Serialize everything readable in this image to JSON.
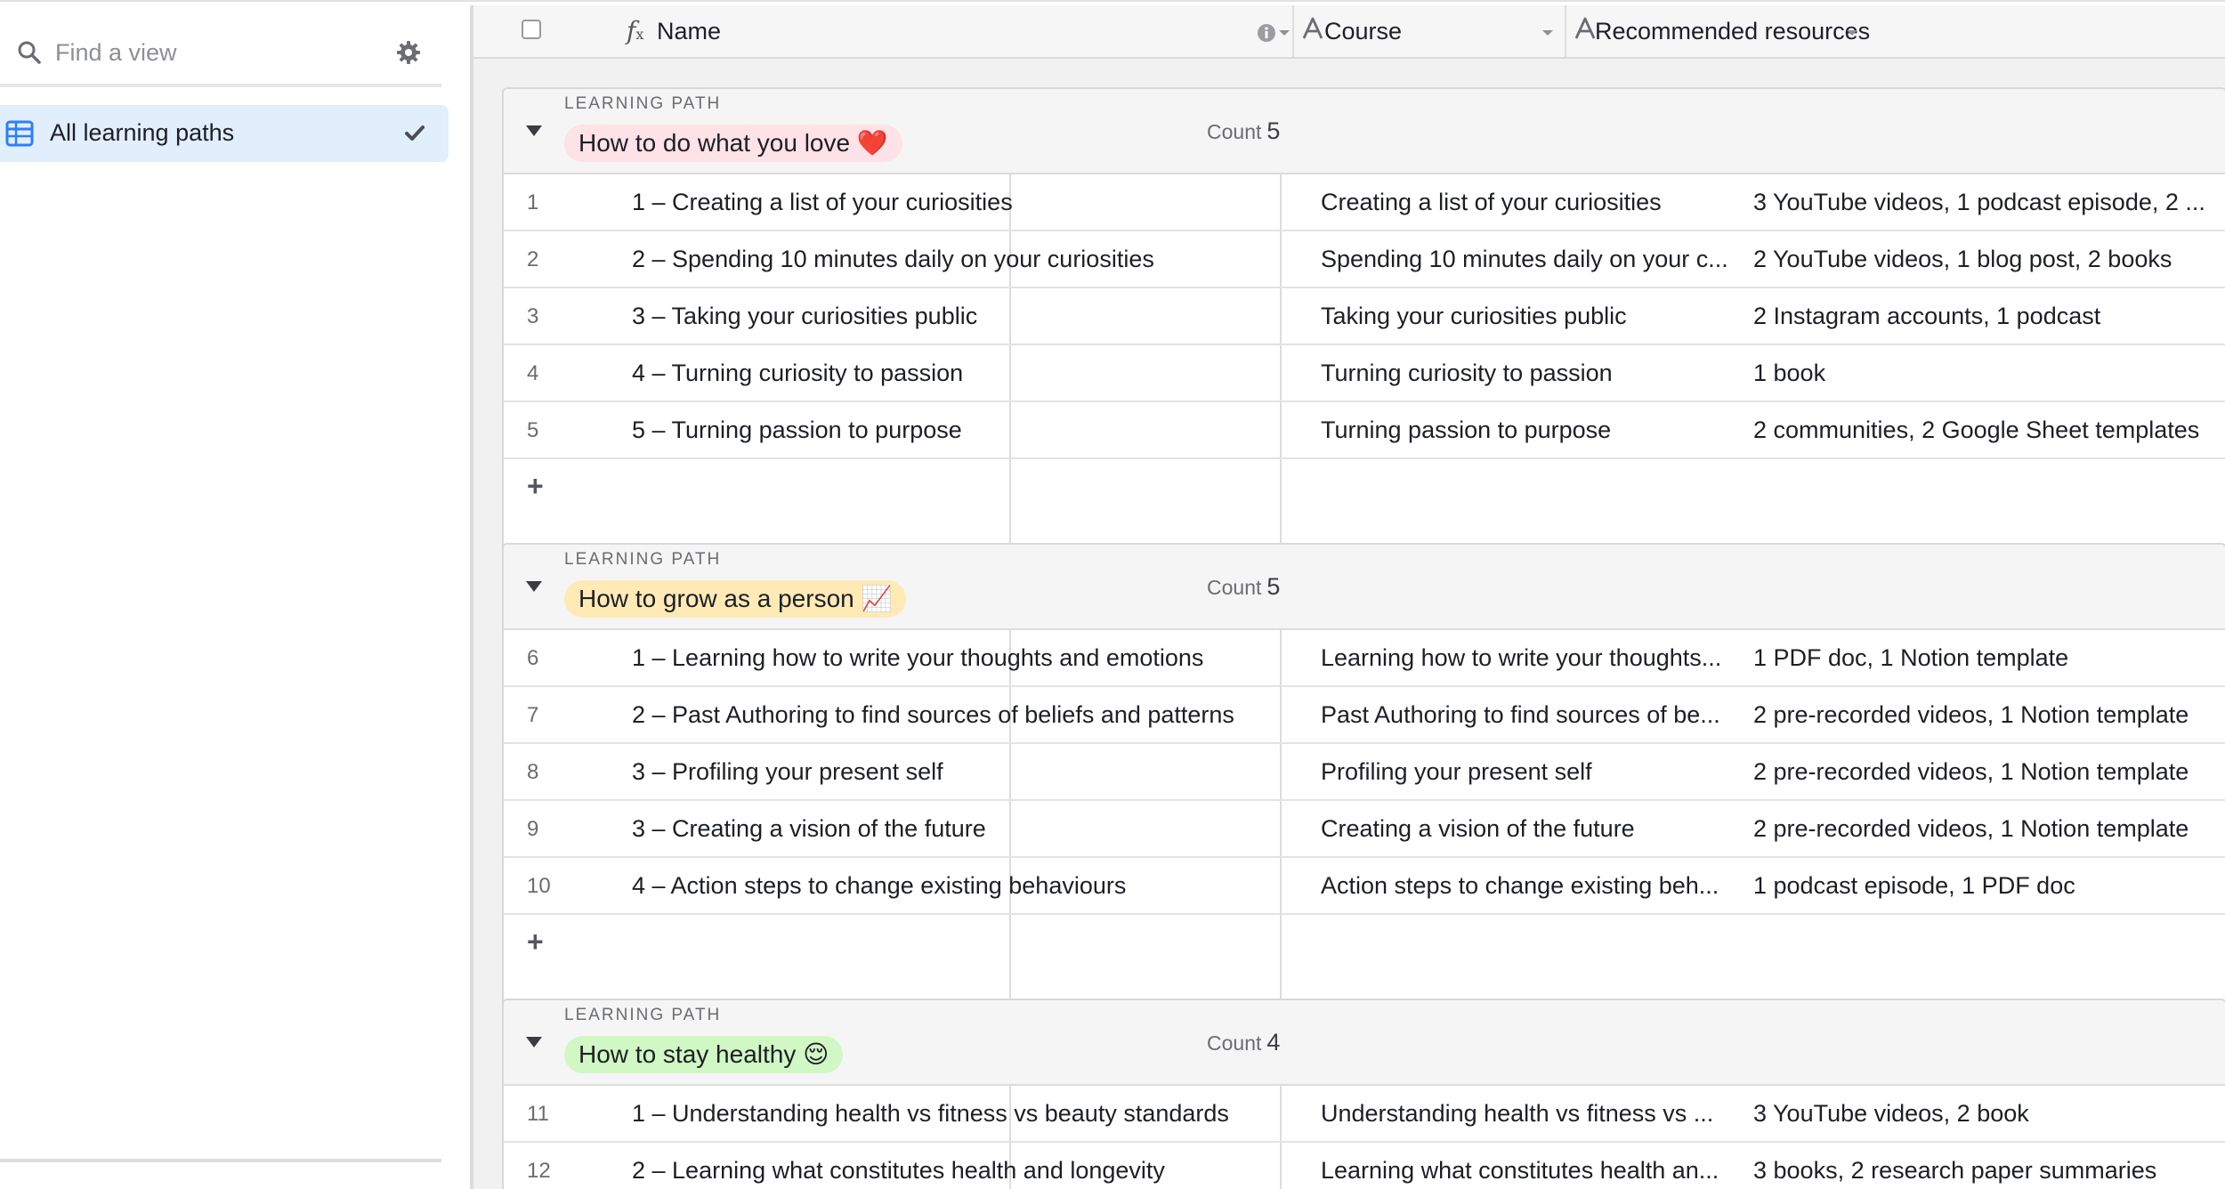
{
  "sidebar": {
    "search_placeholder": "Find a view",
    "views": [
      {
        "label": "All learning paths",
        "active": true
      }
    ]
  },
  "fields": {
    "name": "Name",
    "course": "Course",
    "resources": "Recommended resources"
  },
  "group_label": "LEARNING PATH",
  "count_label": "Count",
  "groups": [
    {
      "title": "How to do what you love ❤️",
      "color": "#fde2e8",
      "count": "5",
      "rows": [
        {
          "num": "1",
          "name": "1 – Creating a list of your curiosities",
          "course": "Creating a list of your curiosities",
          "resources": "3 YouTube videos, 1 podcast episode, 2 ..."
        },
        {
          "num": "2",
          "name": "2 – Spending 10 minutes daily on your curiosities",
          "course": "Spending 10 minutes daily on your c...",
          "resources": "2 YouTube videos, 1 blog post, 2 books"
        },
        {
          "num": "3",
          "name": "3 – Taking your curiosities public",
          "course": "Taking your curiosities public",
          "resources": "2 Instagram accounts, 1 podcast"
        },
        {
          "num": "4",
          "name": "4 – Turning curiosity to passion",
          "course": "Turning curiosity to passion",
          "resources": "1 book"
        },
        {
          "num": "5",
          "name": "5 – Turning passion to purpose",
          "course": "Turning passion to purpose",
          "resources": "2 communities, 2 Google Sheet templates"
        }
      ]
    },
    {
      "title": "How to grow as a person 📈",
      "color": "#ffeab6",
      "count": "5",
      "rows": [
        {
          "num": "6",
          "name": "1 – Learning how to write your thoughts and emotions",
          "course": "Learning how to write your thoughts...",
          "resources": "1 PDF doc, 1 Notion template"
        },
        {
          "num": "7",
          "name": "2 – Past Authoring to find sources of beliefs and patterns",
          "course": "Past Authoring to find sources of be...",
          "resources": "2 pre-recorded videos, 1 Notion template"
        },
        {
          "num": "8",
          "name": "3 – Profiling your present self",
          "course": "Profiling your present self",
          "resources": "2 pre-recorded videos, 1 Notion template"
        },
        {
          "num": "9",
          "name": "3 – Creating a vision of the future",
          "course": "Creating a vision of the future",
          "resources": "2 pre-recorded videos, 1 Notion template"
        },
        {
          "num": "10",
          "name": "4 – Action steps to change existing behaviours",
          "course": "Action steps to change existing beh...",
          "resources": "1 podcast episode, 1 PDF doc"
        }
      ]
    },
    {
      "title": "How to stay healthy 😌",
      "color": "#d1f7c4",
      "count": "4",
      "rows": [
        {
          "num": "11",
          "name": "1 – Understanding health vs fitness vs beauty standards",
          "course": "Understanding health vs fitness vs ...",
          "resources": "3 YouTube videos, 2 book"
        },
        {
          "num": "12",
          "name": "2 – Learning what constitutes health and longevity",
          "course": "Learning what constitutes health an...",
          "resources": "3 books, 2 research paper summaries"
        }
      ]
    }
  ]
}
